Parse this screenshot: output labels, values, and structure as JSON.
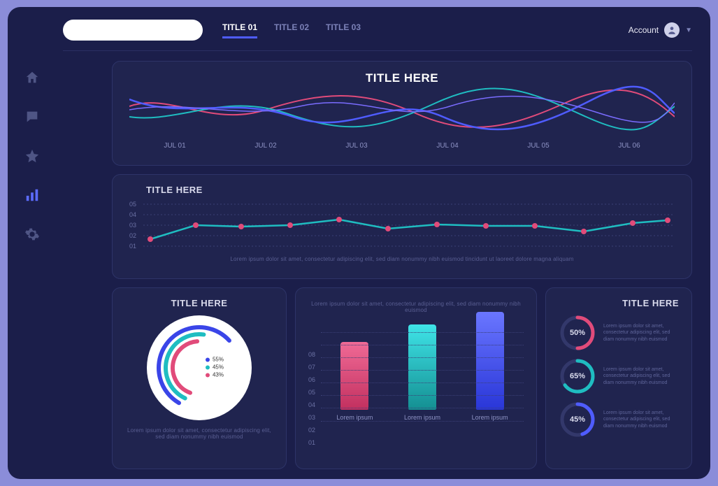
{
  "header": {
    "search_placeholder": "",
    "tabs": [
      "TITLE 01",
      "TITLE 02",
      "TITLE 03"
    ],
    "account_label": "Account"
  },
  "sidebar": {
    "items": [
      "home",
      "chat",
      "star",
      "chart",
      "settings"
    ],
    "active_index": 3
  },
  "top_chart": {
    "title": "TITLE HERE",
    "xlabels": [
      "JUL 01",
      "JUL 02",
      "JUL 03",
      "JUL 04",
      "JUL 05",
      "JUL 06"
    ]
  },
  "line_chart": {
    "title": "TITLE HERE",
    "ylabels": [
      "05",
      "04",
      "03",
      "02",
      "01"
    ],
    "lorem": "Lorem ipsum dolor sit amet, consectetur adipiscing elit, sed diam nonummy nibh euismod tincidunt ut laoreet dolore magna aliquam"
  },
  "pie_card": {
    "title": "TITLE HERE",
    "legend": [
      {
        "label": "55%",
        "color": "#3a45e8"
      },
      {
        "label": "45%",
        "color": "#1fbdc1"
      },
      {
        "label": "43%",
        "color": "#e14b7a"
      }
    ],
    "lorem": "Lorem ipsum dolor sit amet, consectetur adipiscing elit, sed diam nonummy nibh euismod"
  },
  "bar_chart": {
    "ylabels": [
      "01",
      "02",
      "03",
      "04",
      "05",
      "06",
      "07",
      "08"
    ],
    "bars": [
      {
        "label": "Lorem ipsum",
        "value": 5.4,
        "color1": "#e14b7a",
        "color2": "#c2305f"
      },
      {
        "label": "Lorem ipsum",
        "value": 6.8,
        "color1": "#1fbdc1",
        "color2": "#148f92"
      },
      {
        "label": "Lorem ipsum",
        "value": 7.8,
        "color1": "#4f5cff",
        "color2": "#2936d8"
      }
    ],
    "lorem": "Lorem ipsum dolor sit amet, consectetur adipiscing elit, sed diam nonummy nibh euismod"
  },
  "stats_card": {
    "title": "TITLE HERE",
    "rings": [
      {
        "pct": 50,
        "label": "50%",
        "color": "#e14b7a",
        "text": "Lorem ipsum dolor sit amet, consectetur adipiscing elit, sed diam nonummy nibh euismod"
      },
      {
        "pct": 65,
        "label": "65%",
        "color": "#1fbdc1",
        "text": "Lorem ipsum dolor sit amet, consectetur adipiscing elit, sed diam nonummy nibh euismod"
      },
      {
        "pct": 45,
        "label": "45%",
        "color": "#4f5cff",
        "text": "Lorem ipsum dolor sit amet, consectetur adipiscing elit, sed diam nonummy nibh euismod"
      }
    ]
  },
  "chart_data": [
    {
      "type": "line",
      "title": "TITLE HERE",
      "x": [
        "JUL 01",
        "JUL 02",
        "JUL 03",
        "JUL 04",
        "JUL 05",
        "JUL 06"
      ],
      "series": [
        {
          "name": "series-a",
          "color": "#e14b7a",
          "values": [
            3.0,
            1.8,
            3.6,
            2.2,
            3.4,
            2.0
          ]
        },
        {
          "name": "series-b",
          "color": "#1fbdc1",
          "values": [
            2.0,
            3.5,
            2.0,
            3.6,
            2.0,
            3.5
          ]
        },
        {
          "name": "series-c",
          "color": "#4f5cff",
          "values": [
            3.4,
            2.0,
            3.4,
            1.8,
            3.6,
            2.2
          ]
        },
        {
          "name": "series-d",
          "color": "#7a6cff",
          "values": [
            2.4,
            3.0,
            2.4,
            3.0,
            2.4,
            3.0
          ]
        }
      ],
      "yrange": [
        1,
        4
      ]
    },
    {
      "type": "line",
      "title": "TITLE HERE",
      "ylabels": [
        "01",
        "02",
        "03",
        "04",
        "05"
      ],
      "points": [
        2.0,
        3.0,
        2.9,
        3.0,
        3.4,
        2.8,
        3.1,
        3.0,
        3.0,
        2.6,
        3.2,
        3.4
      ],
      "yrange": [
        1,
        5
      ],
      "color": "#1fbdc1",
      "point_color": "#e14b7a"
    },
    {
      "type": "pie",
      "title": "TITLE HERE",
      "slices": [
        {
          "label": "55%",
          "value": 55,
          "color": "#3a45e8"
        },
        {
          "label": "45%",
          "value": 45,
          "color": "#1fbdc1"
        },
        {
          "label": "43%",
          "value": 43,
          "color": "#e14b7a"
        }
      ]
    },
    {
      "type": "bar",
      "categories": [
        "Lorem ipsum",
        "Lorem ipsum",
        "Lorem ipsum"
      ],
      "values": [
        5.4,
        6.8,
        7.8
      ],
      "colors": [
        "#e14b7a",
        "#1fbdc1",
        "#4f5cff"
      ],
      "ylim": [
        0,
        8
      ]
    },
    {
      "type": "gauge",
      "title": "TITLE HERE",
      "items": [
        {
          "pct": 50,
          "color": "#e14b7a"
        },
        {
          "pct": 65,
          "color": "#1fbdc1"
        },
        {
          "pct": 45,
          "color": "#4f5cff"
        }
      ]
    }
  ]
}
